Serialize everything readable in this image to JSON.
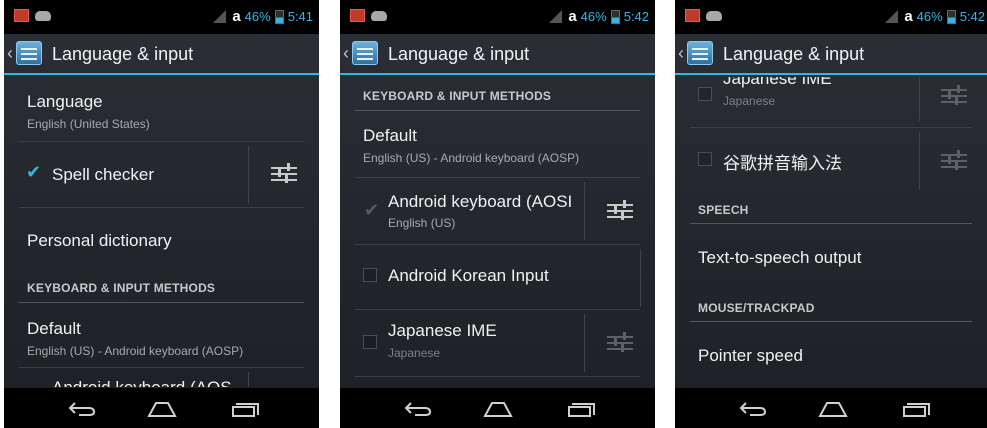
{
  "status_bar": {
    "carrier": "a",
    "battery": "46%",
    "screens": [
      {
        "time": "5:41"
      },
      {
        "time": "5:42"
      },
      {
        "time": "5:42"
      }
    ]
  },
  "action_bar": {
    "title": "Language & input"
  },
  "screen1": {
    "language_title": "Language",
    "language_summary": "English (United States)",
    "spell_checker": "Spell checker",
    "personal_dictionary": "Personal dictionary",
    "keyboard_header": "KEYBOARD & INPUT METHODS",
    "default_title": "Default",
    "default_summary": "English (US) - Android keyboard (AOSP)",
    "cut_row": "Android keyboard (AOS"
  },
  "screen2": {
    "keyboard_header": "KEYBOARD & INPUT METHODS",
    "default_title": "Default",
    "default_summary": "English (US) - Android keyboard (AOSP)",
    "android_keyboard_title": "Android keyboard (AOSI",
    "android_keyboard_summary": "English (US)",
    "korean_title": "Android Korean Input",
    "japanese_title": "Japanese IME",
    "japanese_summary": "Japanese"
  },
  "screen3": {
    "japanese_title": "Japanese IME",
    "japanese_summary": "Japanese",
    "pinyin_title": "谷歌拼音输入法",
    "speech_header": "SPEECH",
    "tts_title": "Text-to-speech output",
    "mouse_header": "MOUSE/TRACKPAD",
    "pointer_title": "Pointer speed"
  },
  "icons": {
    "back": "back-icon",
    "home": "home-icon",
    "recent": "recent-apps-icon",
    "settings": "settings-sliders-icon"
  },
  "colors": {
    "accent": "#33b5e5",
    "background": "#22262b"
  }
}
